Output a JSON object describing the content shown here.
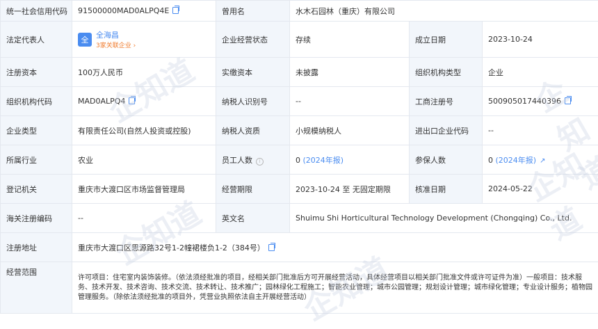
{
  "rows": [
    {
      "cells": [
        {
          "label": "统一社会信用代码",
          "value": "91500000MAD0ALPQ4E"
        },
        {
          "label": "曾用名",
          "value": "水木石园林（重庆）有限公司"
        }
      ]
    },
    {
      "rep_label": "法定代表人",
      "rep_avatar": "全",
      "rep_name": "全海昌",
      "rep_sub": "3家关联企业 ›",
      "cells": [
        {
          "label": "企业经营状态",
          "value": "存续"
        },
        {
          "label": "成立日期",
          "value": "2023-10-24"
        }
      ]
    },
    {
      "cells": [
        {
          "label": "注册资本",
          "value": "100万人民币"
        },
        {
          "label": "实缴资本",
          "value": "未披露"
        },
        {
          "label": "组织机构类型",
          "value": "企业"
        }
      ]
    },
    {
      "cells": [
        {
          "label": "组织机构代码",
          "value": "MAD0ALPQ4"
        },
        {
          "label": "纳税人识别号",
          "value": "--"
        },
        {
          "label": "工商注册号",
          "value": "500905017440396"
        }
      ]
    },
    {
      "cells": [
        {
          "label": "企业类型",
          "value": "有限责任公司(自然人投资或控股)"
        },
        {
          "label": "纳税人资质",
          "value": "小规模纳税人"
        },
        {
          "label": "进出口企业代码",
          "value": "--"
        }
      ]
    },
    {
      "cells": [
        {
          "label": "所属行业",
          "value": "农业"
        },
        {
          "label": "员工人数",
          "value": "0",
          "extra": "(2024年报)"
        },
        {
          "label": "参保人数",
          "value": "0",
          "extra": "(2024年报)"
        }
      ]
    },
    {
      "cells": [
        {
          "label": "登记机关",
          "value": "重庆市大渡口区市场监督管理局"
        },
        {
          "label": "经营期限",
          "value": "2023-10-24 至 无固定期限"
        },
        {
          "label": "核准日期",
          "value": "2024-05-22"
        }
      ]
    },
    {
      "cells": [
        {
          "label": "海关注册编码",
          "value": "--"
        },
        {
          "label": "英文名",
          "value": "Shuimu Shi Horticultural Technology Development (Chongqing) Co., Ltd."
        }
      ]
    },
    {
      "cells": [
        {
          "label": "注册地址",
          "value": "重庆市大渡口区思源路32号1-2幢裙楼负1-2（384号）"
        }
      ]
    },
    {
      "cells": [
        {
          "label": "经营范围",
          "value": "许可项目：住宅室内装饰装修。（依法须经批准的项目，经相关部门批准后方可开展经营活动，具体经营项目以相关部门批准文件或许可证件为准）一般项目：技术服务、技术开发、技术咨询、技术交流、技术转让、技术推广；园林绿化工程施工；智能农业管理；城市公园管理；规划设计管理；城市绿化管理；专业设计服务；植物园管理服务。（除依法须经批准的项目外，凭营业执照依法自主开展经营活动）"
        }
      ]
    }
  ],
  "watermark": "企知道",
  "colors": {
    "label_bg": "#f2f6fb",
    "accent": "#4a8cf0",
    "orange": "#f07b2c",
    "border": "#e4e8ef"
  }
}
